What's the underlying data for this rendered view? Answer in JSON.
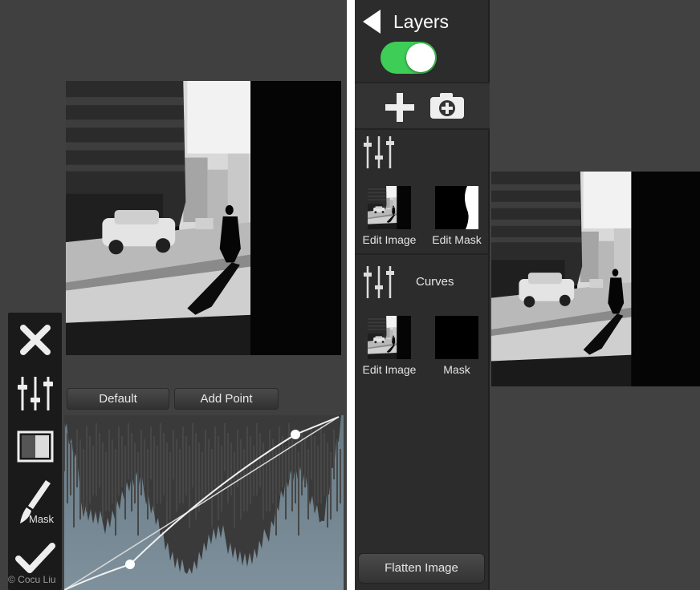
{
  "left_screen": {
    "buttons": {
      "default_label": "Default",
      "add_point_label": "Add Point"
    },
    "toolbar": {
      "close_icon": "close-icon",
      "adjust_icon": "sliders-icon",
      "compare_icon": "compare-icon",
      "mask_icon": "brush-icon",
      "mask_label": "Mask",
      "confirm_icon": "check-icon"
    },
    "credit": "© Cocu Liu"
  },
  "layers_panel": {
    "title": "Layers",
    "toggle_on": true,
    "add_icon": "plus-icon",
    "camera_icon": "camera-add-icon",
    "layer_top": {
      "icon": "sliders-icon",
      "thumb_label_1": "Edit Image",
      "thumb_label_2": "Edit Mask"
    },
    "layer_curves": {
      "icon": "sliders-icon",
      "name": "Curves",
      "thumb_label_1": "Edit Image",
      "thumb_label_2": "Mask"
    },
    "flatten_label": "Flatten Image"
  },
  "colors": {
    "toggle_green": "#3ecd57",
    "panel_bg": "#2c2c2c",
    "canvas_bg": "#404040"
  }
}
